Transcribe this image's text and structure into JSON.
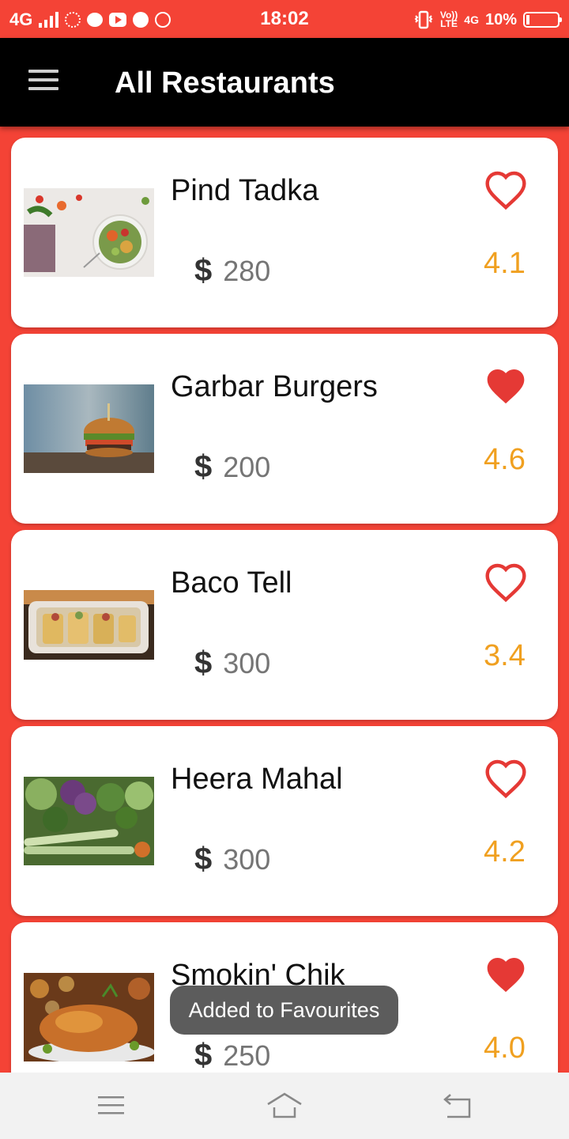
{
  "status_bar": {
    "network": "4G",
    "time": "18:02",
    "lte_top": "Vo))",
    "lte_bottom": "LTE",
    "net2": "4G",
    "battery": "10%",
    "battery_level": 0.1
  },
  "app_bar": {
    "title": "All Restaurants",
    "menu_icon": "hamburger-menu-icon"
  },
  "restaurants": [
    {
      "name": "Pind Tadka",
      "currency": "$",
      "price": "280",
      "rating": "4.1",
      "favourite": false,
      "image": "salad-bowl"
    },
    {
      "name": "Garbar Burgers",
      "currency": "$",
      "price": "200",
      "rating": "4.6",
      "favourite": true,
      "image": "burger"
    },
    {
      "name": "Baco Tell",
      "currency": "$",
      "price": "300",
      "rating": "3.4",
      "favourite": false,
      "image": "rolls-dish"
    },
    {
      "name": "Heera Mahal",
      "currency": "$",
      "price": "300",
      "rating": "4.2",
      "favourite": false,
      "image": "vegetables"
    },
    {
      "name": "Smokin' Chik",
      "currency": "$",
      "price": "250",
      "rating": "4.0",
      "favourite": true,
      "image": "roast-chicken"
    }
  ],
  "toast": {
    "text": "Added to Favourites"
  },
  "nav_bar": {
    "items": [
      "menu-icon",
      "home-icon",
      "back-icon"
    ]
  },
  "colors": {
    "accent": "#f44336",
    "app_bar": "#000000",
    "rating": "#f0a020",
    "heart": "#e53935"
  }
}
